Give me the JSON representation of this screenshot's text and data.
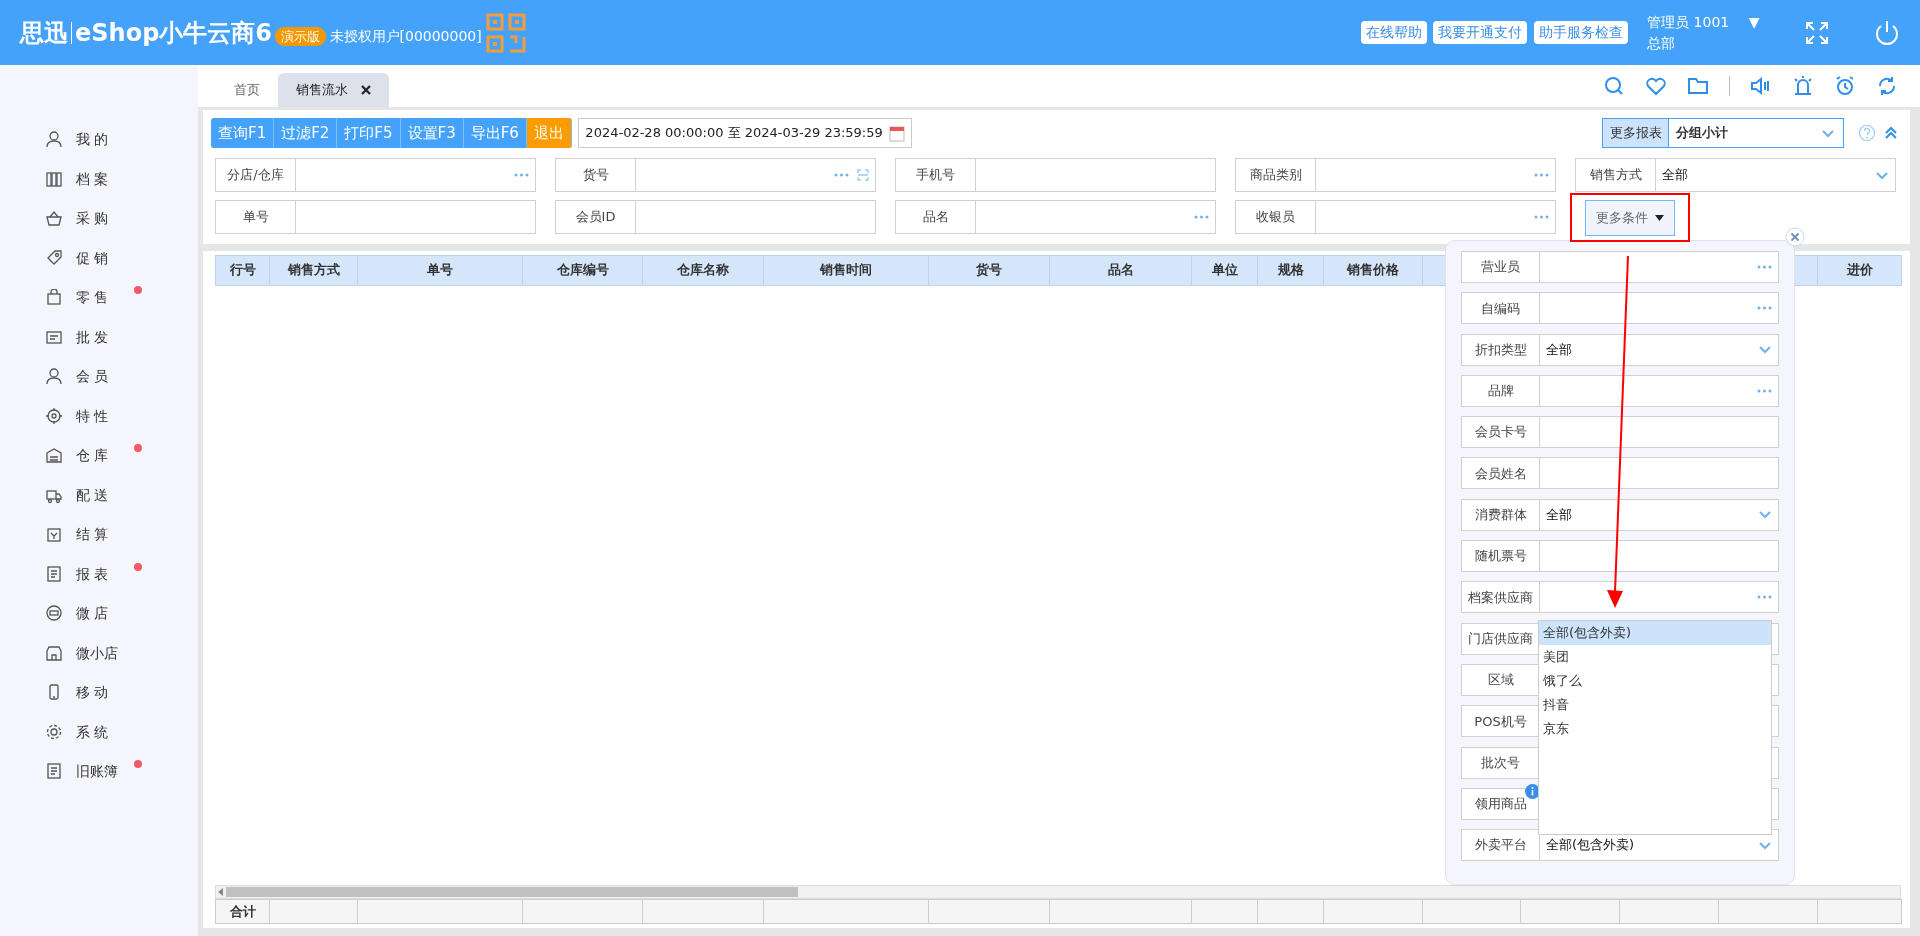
{
  "header": {
    "logo_brand": "思迅",
    "logo_product": "eShop小牛云商6",
    "edition_badge": "演示版",
    "license": "未授权用户[00000000]",
    "links": [
      "在线帮助",
      "我要开通支付",
      "助手服务检查"
    ],
    "user": "管理员 1001",
    "user_caret": "▼",
    "branch": "总部"
  },
  "sidebar": {
    "items": [
      {
        "label": "我 的",
        "alert": false
      },
      {
        "label": "档 案",
        "alert": false
      },
      {
        "label": "采 购",
        "alert": false
      },
      {
        "label": "促 销",
        "alert": false
      },
      {
        "label": "零 售",
        "alert": true
      },
      {
        "label": "批 发",
        "alert": false
      },
      {
        "label": "会 员",
        "alert": false
      },
      {
        "label": "特 性",
        "alert": false
      },
      {
        "label": "仓 库",
        "alert": true
      },
      {
        "label": "配 送",
        "alert": false
      },
      {
        "label": "结 算",
        "alert": false
      },
      {
        "label": "报 表",
        "alert": true
      },
      {
        "label": "微 店",
        "alert": false
      },
      {
        "label": "微小店",
        "alert": false
      },
      {
        "label": "移 动",
        "alert": false
      },
      {
        "label": "系 统",
        "alert": false
      },
      {
        "label": "旧账簿",
        "alert": true
      }
    ]
  },
  "tabs": [
    {
      "label": "首页",
      "selected": false,
      "closable": false
    },
    {
      "label": "销售流水",
      "selected": true,
      "closable": true
    }
  ],
  "toolbar": {
    "buttons": [
      {
        "label": "查询F1",
        "kind": "primary"
      },
      {
        "label": "过滤F2",
        "kind": "primary"
      },
      {
        "label": "打印F5",
        "kind": "primary"
      },
      {
        "label": "设置F3",
        "kind": "primary"
      },
      {
        "label": "导出F6",
        "kind": "primary"
      },
      {
        "label": "退出",
        "kind": "warning"
      }
    ],
    "date_from": "2024-02-28 00:00:00",
    "date_sep": "至",
    "date_to": "2024-03-29 23:59:59",
    "report_label": "更多报表",
    "report_value": "分组小计"
  },
  "filters": [
    {
      "label": "分店/仓库",
      "kind": "picker"
    },
    {
      "label": "货号",
      "kind": "picker",
      "scan": true
    },
    {
      "label": "手机号",
      "kind": "text"
    },
    {
      "label": "商品类别",
      "kind": "picker"
    },
    {
      "label": "销售方式",
      "kind": "select",
      "value": "全部"
    },
    {
      "label": "单号",
      "kind": "text"
    },
    {
      "label": "会员ID",
      "kind": "text"
    },
    {
      "label": "品名",
      "kind": "picker"
    },
    {
      "label": "收银员",
      "kind": "picker"
    }
  ],
  "more_button": {
    "label": "更多条件",
    "expanded": true
  },
  "table": {
    "columns": [
      "行号",
      "销售方式",
      "单号",
      "仓库编号",
      "仓库名称",
      "销售时间",
      "货号",
      "品名",
      "单位",
      "规格",
      "销售价格",
      "进价"
    ],
    "footer_label": "合计"
  },
  "more_conditions": {
    "fields": [
      {
        "label": "营业员",
        "kind": "picker"
      },
      {
        "label": "自编码",
        "kind": "picker"
      },
      {
        "label": "折扣类型",
        "kind": "select",
        "value": "全部"
      },
      {
        "label": "品牌",
        "kind": "picker"
      },
      {
        "label": "会员卡号",
        "kind": "text"
      },
      {
        "label": "会员姓名",
        "kind": "text"
      },
      {
        "label": "消费群体",
        "kind": "select",
        "value": "全部"
      },
      {
        "label": "随机票号",
        "kind": "text"
      },
      {
        "label": "档案供应商",
        "kind": "picker"
      },
      {
        "label": "门店供应商",
        "kind": "text"
      },
      {
        "label": "区域",
        "kind": "text"
      },
      {
        "label": "POS机号",
        "kind": "text"
      },
      {
        "label": "批次号",
        "kind": "text"
      },
      {
        "label": "领用商品",
        "kind": "text",
        "info": true
      },
      {
        "label": "外卖平台",
        "kind": "select",
        "value": "全部(包含外卖)"
      }
    ],
    "open_list": {
      "items": [
        {
          "label": "全部(包含外卖)",
          "selected": true
        },
        {
          "label": "美团",
          "selected": false
        },
        {
          "label": "饿了么",
          "selected": false
        },
        {
          "label": "抖音",
          "selected": false
        },
        {
          "label": "京东",
          "selected": false
        }
      ]
    }
  }
}
